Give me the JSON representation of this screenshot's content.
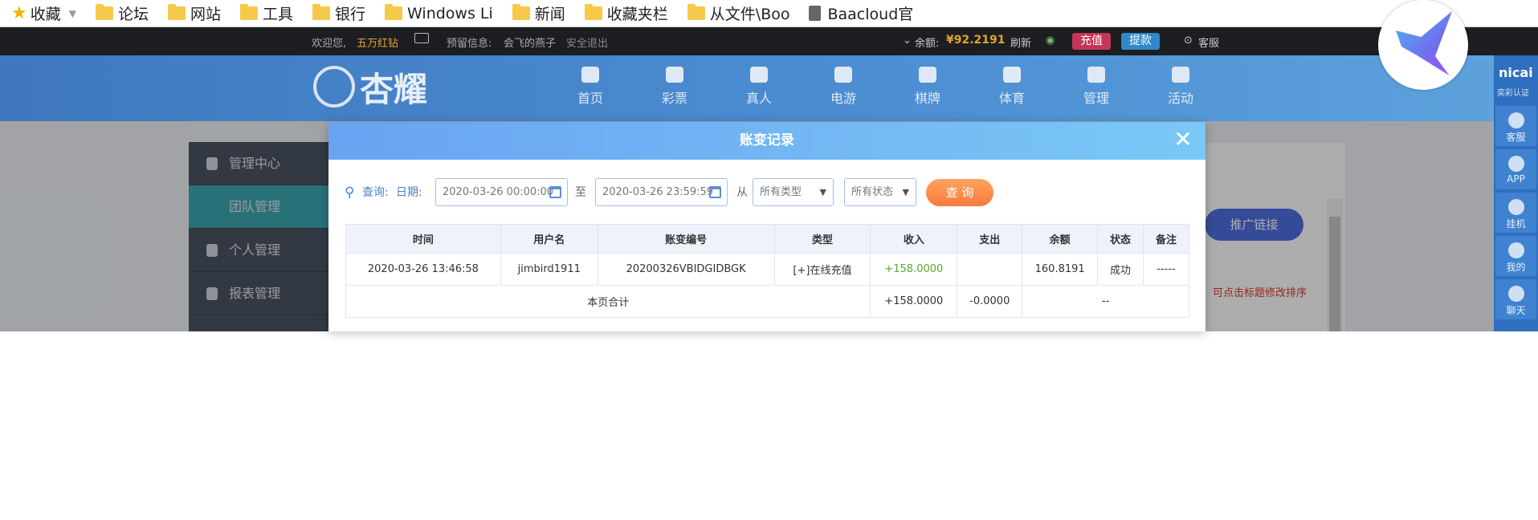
{
  "bookmarks": {
    "favorites_label": "收藏",
    "items": [
      "论坛",
      "网站",
      "工具",
      "银行",
      "Windows Li",
      "新闻",
      "收藏夹栏",
      "从文件\\Boo"
    ],
    "doc_item": "Baacloud官"
  },
  "topbar": {
    "welcome": "欢迎您,",
    "level": "五万红钻",
    "notice_label": "预留信息:",
    "notice_value": "会飞的燕子",
    "logout": "安全退出",
    "balance_label": "余额:",
    "balance_value": "¥92.2191",
    "refresh": "刷新",
    "deposit": "充值",
    "withdraw": "提款",
    "service": "客服"
  },
  "nav": {
    "logo_text": "杏耀",
    "items": [
      "首页",
      "彩票",
      "真人",
      "电游",
      "棋牌",
      "体育",
      "管理",
      "活动"
    ]
  },
  "sidebar": {
    "items": [
      "管理中心",
      "团队管理",
      "个人管理",
      "报表管理"
    ]
  },
  "right_panel": {
    "promo_button": "推广链接",
    "hint": "可点击标题修改排序"
  },
  "float_bar": {
    "brand": "nicai",
    "brand_sub": "奕彩认证",
    "items": [
      "客服",
      "APP",
      "挂机",
      "我的",
      "聊天"
    ]
  },
  "modal": {
    "title": "账变记录",
    "query_label": "查询:",
    "date_label": "日期:",
    "date_from": "2020-03-26 00:00:00",
    "to_label": "至",
    "date_to": "2020-03-26 23:59:59",
    "from_label": "从",
    "type_select": "所有类型",
    "status_select": "所有状态",
    "query_button": "查 询",
    "columns": [
      "时间",
      "用户名",
      "账变编号",
      "类型",
      "收入",
      "支出",
      "余额",
      "状态",
      "备注"
    ],
    "rows": [
      {
        "time": "2020-03-26 13:46:58",
        "username": "jimbird1911",
        "txn_id": "20200326VBIDGIDBGK",
        "type": "[+]在线充值",
        "income": "+158.0000",
        "expense": "",
        "balance": "160.8191",
        "status": "成功",
        "remark": "-----"
      }
    ],
    "summary": {
      "label": "本页合计",
      "income": "+158.0000",
      "expense": "-0.0000",
      "tail": "--"
    }
  }
}
